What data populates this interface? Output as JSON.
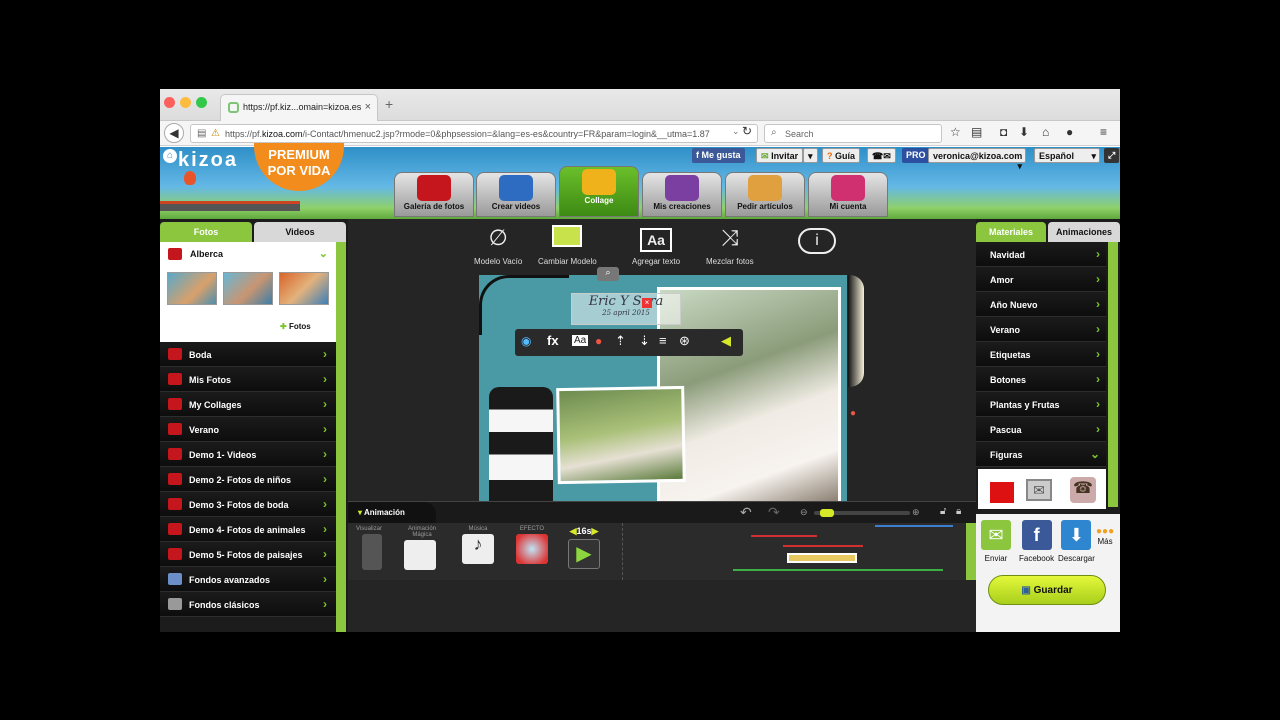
{
  "browser": {
    "tab_title": "https://pf.kiz...omain=kizoa.es",
    "tab_close": "×",
    "new_tab": "+",
    "url_prefix": "https://pf.",
    "url_domain": "kizoa.com",
    "url_rest": "/i-Contact/hmenuc2.jsp?rmode=0&phpsession=&lang=es-es&country=FR&param=login&__utma=1.87",
    "search_placeholder": "Search"
  },
  "header": {
    "logo": "kizoa",
    "premium": "PREMIUM\nPOR VIDA",
    "facebook_like": "Me gusta",
    "invite": "Invitar",
    "guide": "Guía",
    "pro_badge": "PRO",
    "user_email": "veronica@kizoa.com",
    "language": "Español"
  },
  "nav_tabs": [
    {
      "label": "Galería de fotos",
      "color": "#c4161c"
    },
    {
      "label": "Crear videos",
      "color": "#2d6cc0"
    },
    {
      "label": "Collage",
      "color": "#f0b21a"
    },
    {
      "label": "Mis creaciones",
      "color": "#7a3fa0"
    },
    {
      "label": "Pedir artículos",
      "color": "#e0a040"
    },
    {
      "label": "Mi cuenta",
      "color": "#d03070"
    }
  ],
  "left_panel": {
    "tab_photos": "Fotos",
    "tab_videos": "Videos",
    "open_album": "Alberca",
    "fotos_link": "Fotos",
    "albums": [
      {
        "label": "Boda",
        "icon": "album-red"
      },
      {
        "label": "Mis Fotos",
        "icon": "album-red"
      },
      {
        "label": "My Collages",
        "icon": "album-red"
      },
      {
        "label": "Verano",
        "icon": "album-red"
      },
      {
        "label": "Demo 1- Videos",
        "icon": "kizoa-k"
      },
      {
        "label": "Demo 2- Fotos de niños",
        "icon": "kizoa-k"
      },
      {
        "label": "Demo 3- Fotos de boda",
        "icon": "kizoa-k"
      },
      {
        "label": "Demo 4- Fotos de animales",
        "icon": "kizoa-k"
      },
      {
        "label": "Demo 5- Fotos de paisajes",
        "icon": "kizoa-k"
      },
      {
        "label": "Fondos avanzados",
        "icon": "backgrounds"
      },
      {
        "label": "Fondos clásicos",
        "icon": "backgrounds"
      }
    ]
  },
  "toolbar": [
    {
      "label": "Modelo Vacío",
      "icon": "empty-set-icon"
    },
    {
      "label": "Cambiar Modelo",
      "icon": "change-model-icon"
    },
    {
      "label": "Agregar texto",
      "icon": "add-text-icon"
    },
    {
      "label": "Mezclar fotos",
      "icon": "shuffle-icon"
    },
    {
      "label": "",
      "icon": "info-icon"
    }
  ],
  "canvas": {
    "text_line1": "Eric Y Sara",
    "text_line2": "25 april 2015"
  },
  "animation": {
    "label": "Animación",
    "items": [
      {
        "label": "Visualizar"
      },
      {
        "label": "Animación Mágica"
      },
      {
        "label": "Música"
      },
      {
        "label": "EFECTO"
      }
    ],
    "duration": "16s"
  },
  "right_panel": {
    "tab_materials": "Materiales",
    "tab_animations": "Animaciones",
    "categories": [
      "Navidad",
      "Amor",
      "Año Nuevo",
      "Verano",
      "Etiquetas",
      "Botones",
      "Plantas y Frutas",
      "Pascua",
      "Figuras"
    ],
    "share": [
      {
        "label": "Enviar",
        "color": "#8cc63f"
      },
      {
        "label": "Facebook",
        "color": "#3b5998"
      },
      {
        "label": "Descargar",
        "color": "#2e86d1"
      }
    ],
    "more": "Más",
    "save": "Guardar"
  }
}
